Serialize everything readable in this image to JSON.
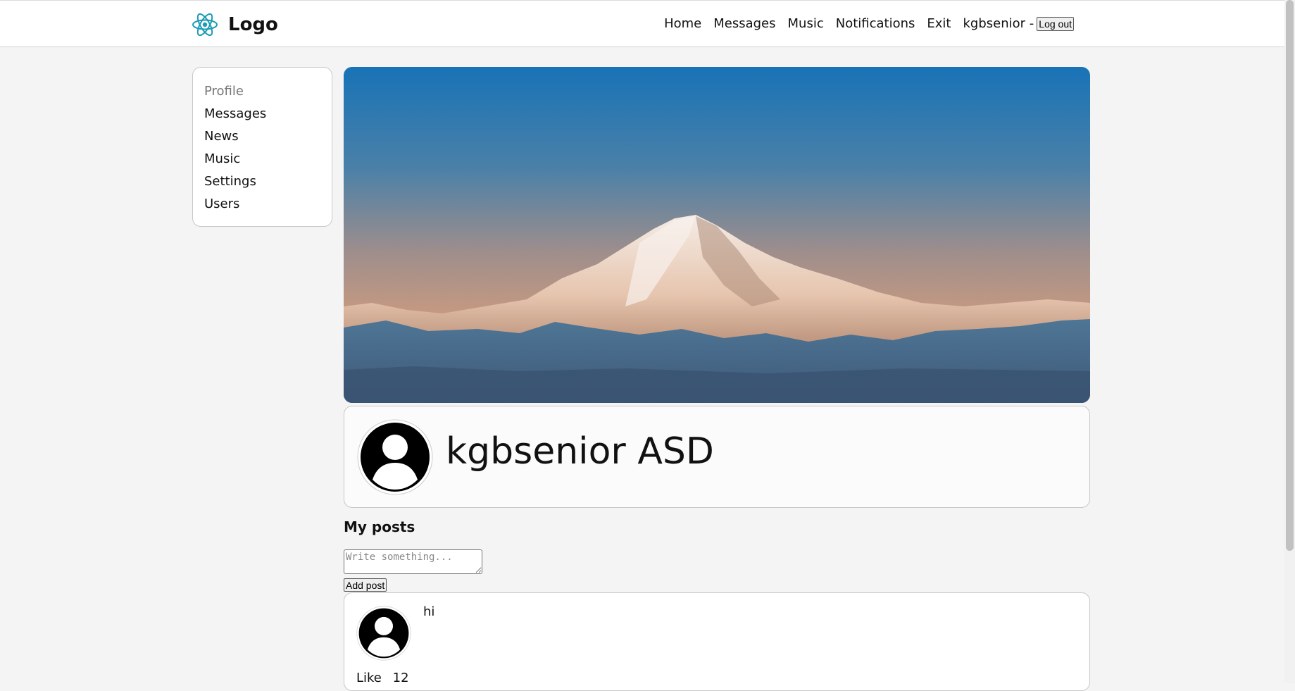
{
  "header": {
    "logo_text": "Logo",
    "logo_icon": "react-atom-icon",
    "nav": [
      "Home",
      "Messages",
      "Music",
      "Notifications",
      "Exit"
    ],
    "user_label": "kgbsenior -",
    "logout_label": "Log out"
  },
  "sidebar": {
    "items": [
      {
        "label": "Profile",
        "active": true
      },
      {
        "label": "Messages"
      },
      {
        "label": "News"
      },
      {
        "label": "Music"
      },
      {
        "label": "Settings"
      },
      {
        "label": "Users"
      }
    ]
  },
  "profile": {
    "name": "kgbsenior ASD",
    "avatar_icon": "user-avatar-icon"
  },
  "posts": {
    "title": "My posts",
    "input_placeholder": "Write something...",
    "add_label": "Add post",
    "items": [
      {
        "text": "hi",
        "like_label": "Like",
        "likes": "12"
      }
    ]
  },
  "colors": {
    "background": "#f4f4f4",
    "header_bg": "#ffffff",
    "react_teal": "#1b9bb4"
  }
}
